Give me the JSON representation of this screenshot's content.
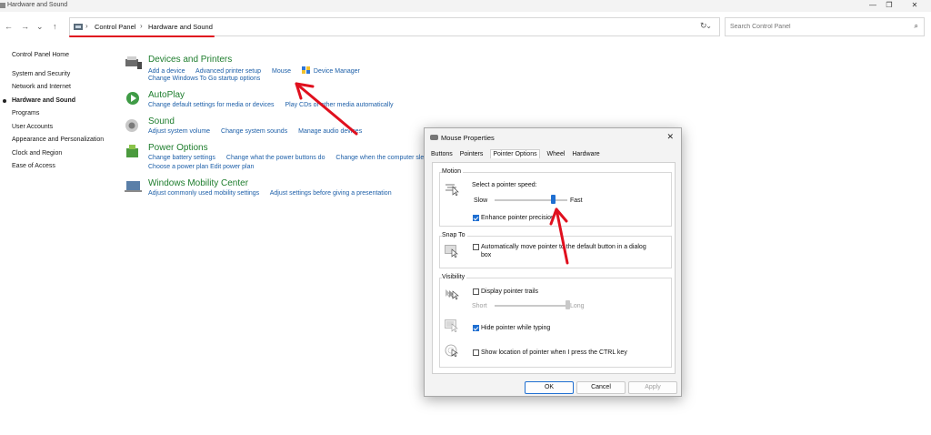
{
  "window": {
    "title": "Hardware and Sound",
    "controls": [
      "—",
      "❐",
      "✕"
    ]
  },
  "nav": {
    "back": "←",
    "forward": "→",
    "recent": "⌄",
    "up": "↑",
    "refresh": "↻",
    "dropdown": "⌄"
  },
  "breadcrumb": [
    "Control Panel",
    "Hardware and Sound"
  ],
  "search": {
    "placeholder": "Search Control Panel"
  },
  "sidebar": {
    "items": [
      {
        "label": "Control Panel Home",
        "active": false
      },
      {
        "label": "System and Security",
        "active": false
      },
      {
        "label": "Network and Internet",
        "active": false
      },
      {
        "label": "Hardware and Sound",
        "active": true
      },
      {
        "label": "Programs",
        "active": false
      },
      {
        "label": "User Accounts",
        "active": false
      },
      {
        "label": "Appearance and Personalization",
        "active": false
      },
      {
        "label": "Clock and Region",
        "active": false
      },
      {
        "label": "Ease of Access",
        "active": false
      }
    ]
  },
  "categories": [
    {
      "title": "Devices and Printers",
      "links": [
        "Add a device",
        "Advanced printer setup",
        "Mouse",
        "Device Manager"
      ],
      "links2": [
        "Change Windows To Go startup options"
      ]
    },
    {
      "title": "AutoPlay",
      "links": [
        "Change default settings for media or devices",
        "Play CDs or other media automatically"
      ],
      "links2": []
    },
    {
      "title": "Sound",
      "links": [
        "Adjust system volume",
        "Change system sounds",
        "Manage audio devices"
      ],
      "links2": []
    },
    {
      "title": "Power Options",
      "links": [
        "Change battery settings",
        "Change what the power buttons do",
        "Change when the computer sleeps"
      ],
      "links2": [
        "Choose a power plan",
        "Edit power plan"
      ]
    },
    {
      "title": "Windows Mobility Center",
      "links": [
        "Adjust commonly used mobility settings",
        "Adjust settings before giving a presentation"
      ],
      "links2": []
    }
  ],
  "dialog": {
    "title": "Mouse Properties",
    "close": "✕",
    "tabs": [
      "Buttons",
      "Pointers",
      "Pointer Options",
      "Wheel",
      "Hardware"
    ],
    "selected_tab": "Pointer Options",
    "motion": {
      "label": "Motion",
      "speed_label": "Select a pointer speed:",
      "slow": "Slow",
      "fast": "Fast",
      "speed_value": 0.8,
      "precision_label": "Enhance pointer precision",
      "precision_checked": true
    },
    "snap": {
      "label": "Snap To",
      "auto_label": "Automatically move pointer to the default button in a dialog",
      "auto_label2": "box",
      "auto_checked": false
    },
    "visibility": {
      "label": "Visibility",
      "trails_label": "Display pointer trails",
      "trails_checked": false,
      "short": "Short",
      "long": "Long",
      "trails_value": 1.0,
      "hide_label": "Hide pointer while typing",
      "hide_checked": true,
      "ctrl_label": "Show location of pointer when I press the CTRL key",
      "ctrl_checked": false
    },
    "buttons": {
      "ok": "OK",
      "cancel": "Cancel",
      "apply": "Apply"
    }
  },
  "colors": {
    "accent": "#1f6fd1",
    "category_title": "#1e7d2d",
    "link": "#1d5fa8",
    "annotation": "#e0101e"
  }
}
